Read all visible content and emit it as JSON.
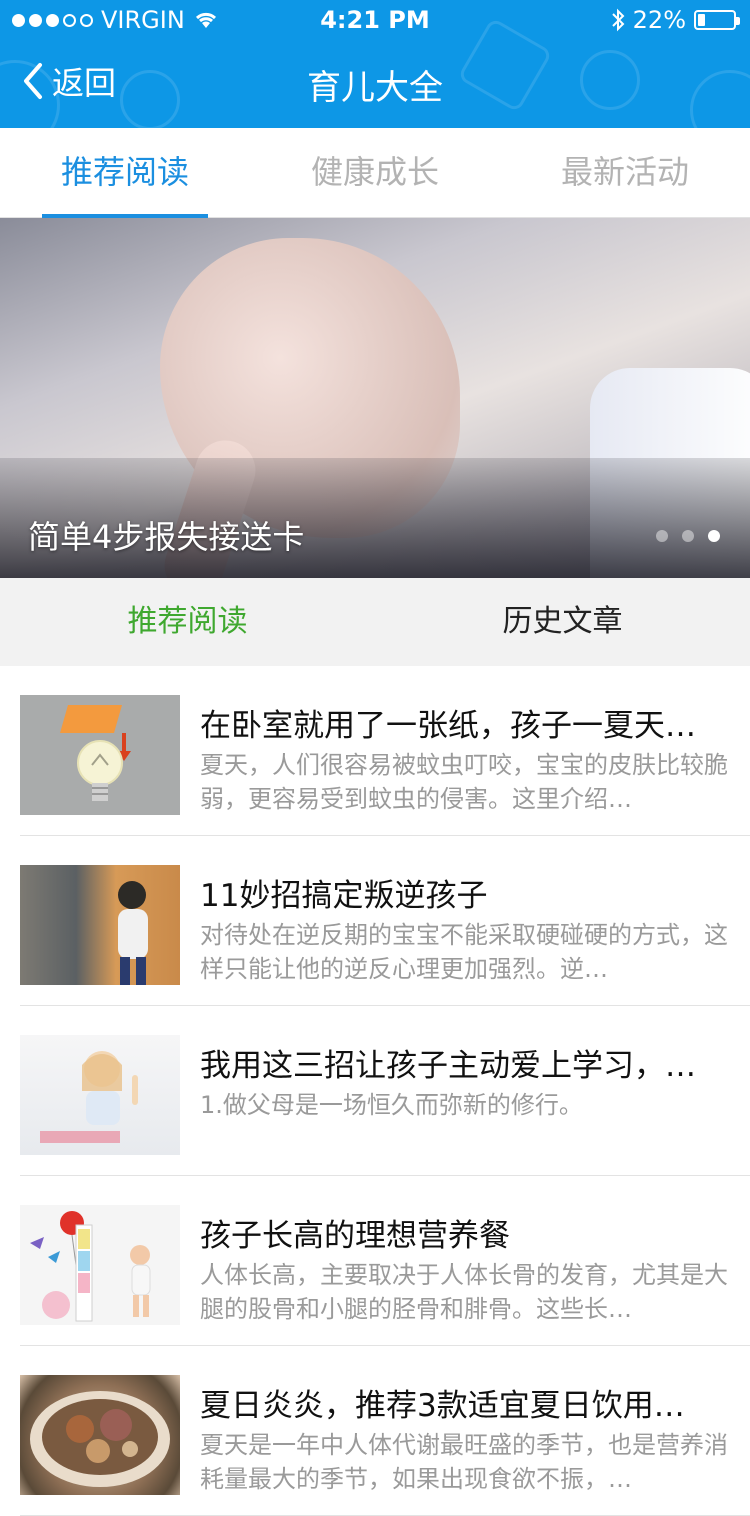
{
  "status_bar": {
    "carrier": "VIRGIN",
    "time": "4:21 PM",
    "battery": "22%",
    "battery_level": 0.22
  },
  "nav": {
    "back_label": "返回",
    "title": "育儿大全"
  },
  "tabs": [
    {
      "label": "推荐阅读",
      "active": true
    },
    {
      "label": "健康成长",
      "active": false
    },
    {
      "label": "最新活动",
      "active": false
    }
  ],
  "banner": {
    "caption": "简单4步报失接送卡",
    "page_count": 3,
    "current_page": 3
  },
  "subtabs": [
    {
      "label": "推荐阅读",
      "active": true
    },
    {
      "label": "历史文章",
      "active": false
    }
  ],
  "articles": [
    {
      "title": "在卧室就用了一张纸，孩子一夏天…",
      "desc": "夏天，人们很容易被蚊虫叮咬，宝宝的皮肤比较脆弱，更容易受到蚊虫的侵害。这里介绍…"
    },
    {
      "title": "11妙招搞定叛逆孩子",
      "desc": "对待处在逆反期的宝宝不能采取硬碰硬的方式，这样只能让他的逆反心理更加强烈。逆…"
    },
    {
      "title": "我用这三招让孩子主动爱上学习，…",
      "desc": "1.做父母是一场恒久而弥新的修行。"
    },
    {
      "title": "孩子长高的理想营养餐",
      "desc": "人体长高，主要取决于人体长骨的发育，尤其是大腿的股骨和小腿的胫骨和腓骨。这些长…"
    },
    {
      "title": "夏日炎炎，推荐3款适宜夏日饮用…",
      "desc": "夏天是一年中人体代谢最旺盛的季节，也是营养消耗量最大的季节，如果出现食欲不振，…"
    }
  ],
  "colors": {
    "header_bg": "#0d97e6",
    "tab_active": "#1b8fe0",
    "subtab_active": "#3fa82f"
  }
}
